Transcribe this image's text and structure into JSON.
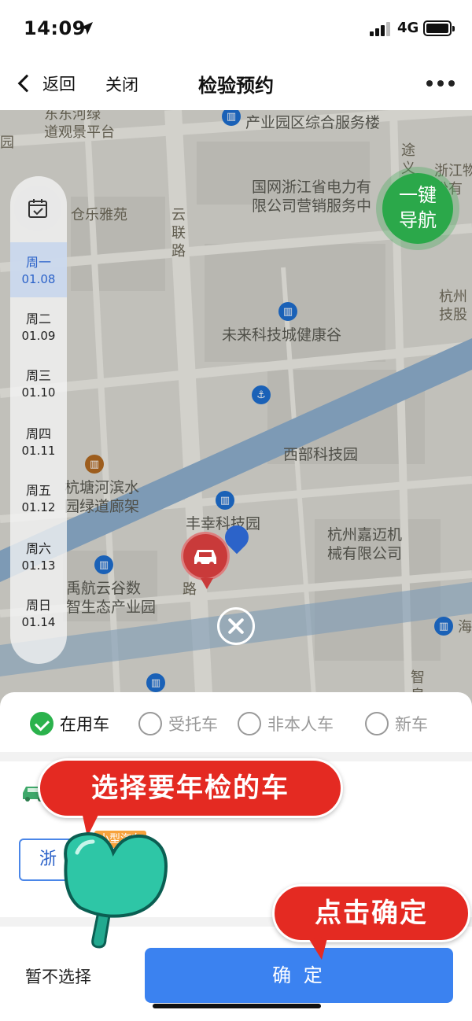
{
  "status_bar": {
    "time": "14:09",
    "network": "4G"
  },
  "nav": {
    "back_label": "返回",
    "close_label": "关闭",
    "title": "检验预约"
  },
  "map": {
    "labels": {
      "park1": "东东河绿\n道观景平台",
      "park2": "仓乐雅苑",
      "service": "产业园区综合服务楼",
      "state_grid": "国网浙江省电力有\n限公司营销服务中",
      "yunlu": "云\n联\n路",
      "tu": "途\n义",
      "zhejiang": "浙江物\n份有",
      "future": "未来科技城健康谷",
      "hangzhou_right": "杭州\n技股",
      "west_park": "西部科技园",
      "hangtang": "杭塘河滨水\n园绿道廊架",
      "fengxing": "丰幸科技园",
      "jiamai": "杭州嘉迈机\n械有限公司",
      "yuhang": "禹航云谷数\n智生态产业园",
      "lu": "路",
      "hai": "海",
      "zhi": "智\n泉",
      "left_edge": "园"
    },
    "nav_button": "一键\n导航"
  },
  "dates": [
    {
      "day": "周一",
      "date": "01.08",
      "selected": true
    },
    {
      "day": "周二",
      "date": "01.09",
      "selected": false
    },
    {
      "day": "周三",
      "date": "01.10",
      "selected": false
    },
    {
      "day": "周四",
      "date": "01.11",
      "selected": false
    },
    {
      "day": "周五",
      "date": "01.12",
      "selected": false
    },
    {
      "day": "周六",
      "date": "01.13",
      "selected": false
    },
    {
      "day": "周日",
      "date": "01.14",
      "selected": false
    }
  ],
  "vehicle_types": [
    {
      "label": "在用车",
      "checked": true
    },
    {
      "label": "受托车",
      "checked": false
    },
    {
      "label": "非本人车",
      "checked": false
    },
    {
      "label": "新车",
      "checked": false
    }
  ],
  "vehicle": {
    "type_badge": "小型汽车",
    "plate_prefix": "浙"
  },
  "actions": {
    "skip": "暂不选择",
    "confirm": "确 定"
  },
  "annotations": {
    "choose_car": "选择要年检的车",
    "tap_confirm": "点击确定"
  },
  "colors": {
    "accent_blue": "#3b82f0",
    "nav_green": "#2ba84a",
    "callout_red": "#e42a22",
    "check_green": "#2bb24c",
    "badge_orange": "#f7a23c"
  }
}
